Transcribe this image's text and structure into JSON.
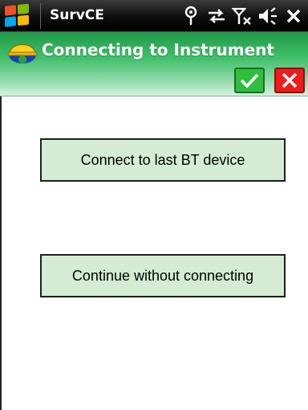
{
  "taskbar": {
    "app_name": "SurvCE",
    "tray_icons": [
      "antenna-icon",
      "sync-icon",
      "signal-off-icon",
      "volume-icon",
      "close-icon"
    ]
  },
  "dialog": {
    "title": "Connecting to Instrument",
    "ok_icon": "check-icon",
    "cancel_icon": "x-icon",
    "app_icon": "helmet-icon"
  },
  "body": {
    "connect_last_label": "Connect to last BT device",
    "continue_label": "Continue without connecting"
  },
  "colors": {
    "title_bar": "#3fbf68",
    "ok_button": "#2fbf3c",
    "cancel_button": "#f21a1a",
    "action_button": "#d4ecd4"
  }
}
